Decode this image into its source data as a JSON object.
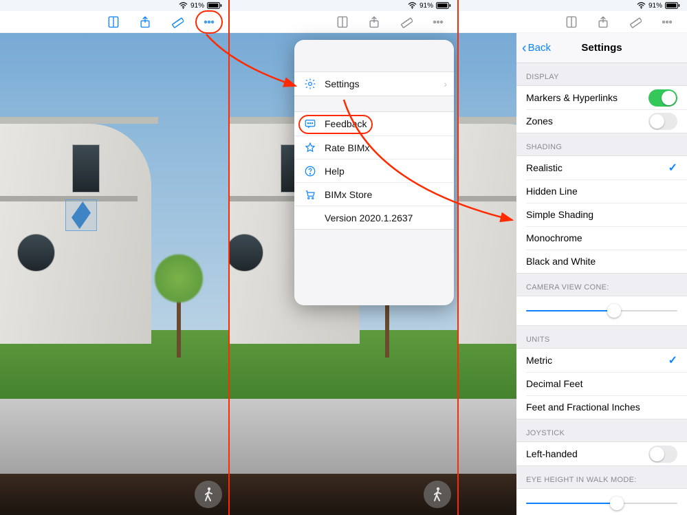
{
  "status": {
    "battery_pct": "91%"
  },
  "panel2": {
    "menu": {
      "settings": "Settings",
      "feedback": "Feedback",
      "rate": "Rate BIMx",
      "help": "Help",
      "store": "BIMx Store",
      "version": "Version 2020.1.2637"
    }
  },
  "panel3": {
    "back": "Back",
    "title": "Settings",
    "sections": {
      "display": "Display",
      "shading": "Shading",
      "camera": "Camera View Cone:",
      "units": "Units",
      "joystick": "Joystick",
      "eye": "Eye Height in Walk Mode:"
    },
    "display_items": {
      "markers": "Markers & Hyperlinks",
      "zones": "Zones"
    },
    "shading_items": {
      "realistic": "Realistic",
      "hidden": "Hidden Line",
      "simple": "Simple Shading",
      "mono": "Monochrome",
      "bw": "Black and White"
    },
    "units_items": {
      "metric": "Metric",
      "decimal": "Decimal Feet",
      "frac": "Feet and Fractional Inches"
    },
    "joystick_items": {
      "left": "Left-handed"
    },
    "camera_slider_pct": 58,
    "eye_slider_pct": 60
  }
}
